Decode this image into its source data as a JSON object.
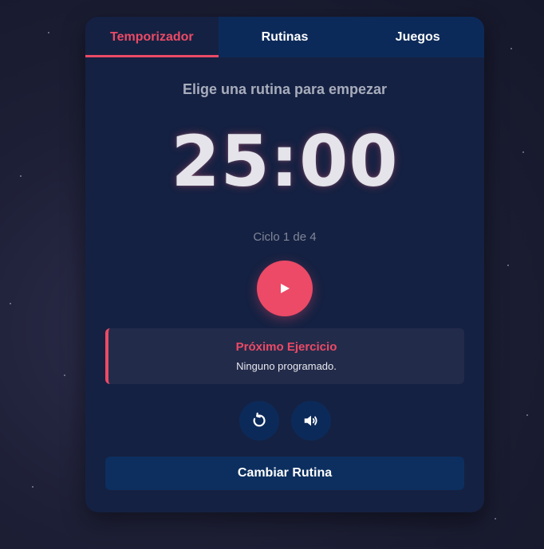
{
  "tabs": [
    {
      "label": "Temporizador",
      "active": true
    },
    {
      "label": "Rutinas",
      "active": false
    },
    {
      "label": "Juegos",
      "active": false
    }
  ],
  "timer": {
    "subtitle": "Elige una rutina para empezar",
    "display": "25:00",
    "cycle": "Ciclo 1 de 4"
  },
  "next_exercise": {
    "title": "Próximo Ejercicio",
    "text": "Ninguno programado."
  },
  "controls": {
    "play_icon": "play-icon",
    "reset_icon": "reset-icon",
    "sound_icon": "volume-icon"
  },
  "change_routine_label": "Cambiar Rutina",
  "colors": {
    "accent": "#ec4a66",
    "card": "#152142",
    "tab_bar": "#0c2a59"
  }
}
